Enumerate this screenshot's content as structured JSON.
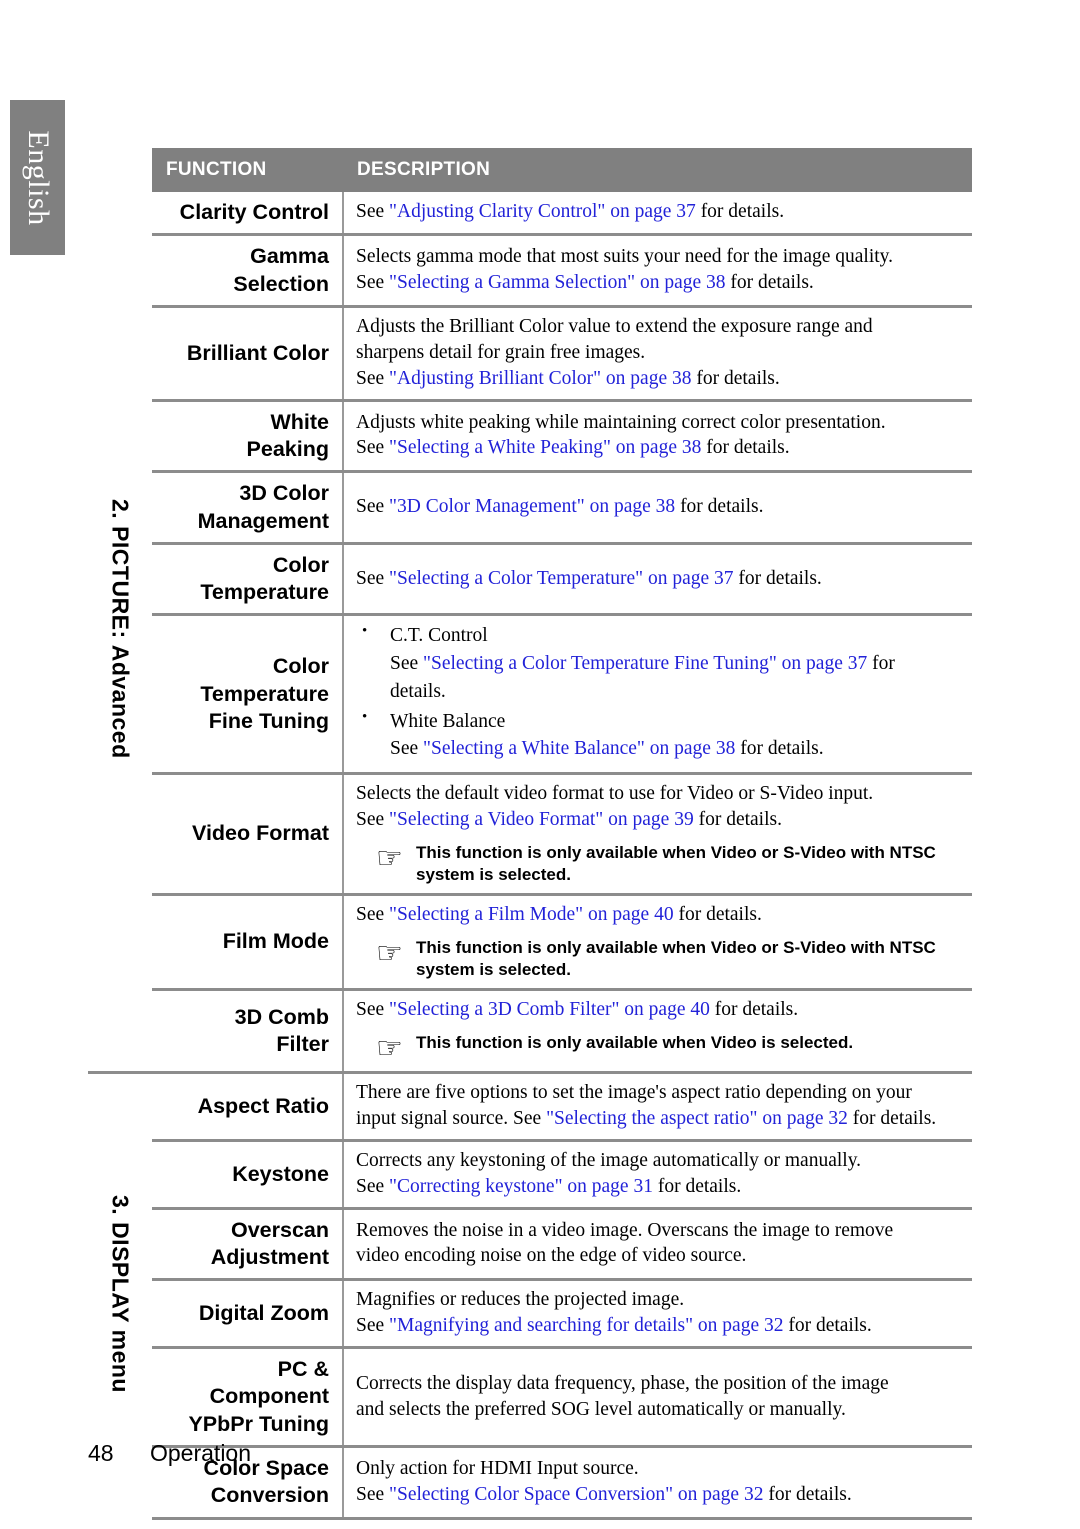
{
  "sidebar": {
    "language_tab": "English"
  },
  "table": {
    "headers": {
      "function": "FUNCTION",
      "description": "DESCRIPTION"
    },
    "sections": [
      {
        "label": "2. PICTURE: Advanced",
        "rows": [
          {
            "function": "Clarity Control",
            "lines": [
              {
                "pre": "See ",
                "link": "\"Adjusting Clarity Control\" on page 37",
                "post": " for details."
              }
            ]
          },
          {
            "function": "Gamma\nSelection",
            "lines": [
              {
                "pre": "Selects gamma mode that most suits your need for the image quality.",
                "link": "",
                "post": ""
              },
              {
                "pre": "See ",
                "link": "\"Selecting a Gamma Selection\" on page 38",
                "post": " for details."
              }
            ]
          },
          {
            "function": "Brilliant Color",
            "lines": [
              {
                "pre": "Adjusts the Brilliant Color value to extend the exposure range and",
                "link": "",
                "post": ""
              },
              {
                "pre": "sharpens detail for grain free images.",
                "link": "",
                "post": ""
              },
              {
                "pre": "See ",
                "link": "\"Adjusting Brilliant Color\" on page 38",
                "post": " for details."
              }
            ]
          },
          {
            "function": "White\nPeaking",
            "lines": [
              {
                "pre": "Adjusts white peaking while maintaining correct color presentation.",
                "link": "",
                "post": ""
              },
              {
                "pre": "See ",
                "link": "\"Selecting a White Peaking\" on page 38",
                "post": " for details."
              }
            ]
          },
          {
            "function": "3D Color\nManagement",
            "lines": [
              {
                "pre": "See ",
                "link": "\"3D Color Management\" on page 38",
                "post": " for details."
              }
            ]
          },
          {
            "function": "Color\nTemperature",
            "lines": [
              {
                "pre": "See ",
                "link": "\"Selecting a Color Temperature\" on page 37",
                "post": " for details."
              }
            ]
          },
          {
            "function": "Color\nTemperature\nFine Tuning",
            "bullets": [
              {
                "title": "C.T. Control",
                "lines": [
                  {
                    "pre": "See ",
                    "link": "\"Selecting a Color Temperature Fine Tuning\" on page 37",
                    "post": " for"
                  },
                  {
                    "pre": "details.",
                    "link": "",
                    "post": ""
                  }
                ]
              },
              {
                "title": "White Balance",
                "lines": [
                  {
                    "pre": "See ",
                    "link": "\"Selecting a White Balance\" on page 38",
                    "post": " for details."
                  }
                ]
              }
            ]
          },
          {
            "function": "Video Format",
            "lines": [
              {
                "pre": "Selects the default video format to use for Video or S-Video input.",
                "link": "",
                "post": ""
              },
              {
                "pre": "See ",
                "link": "\"Selecting a Video Format\" on page 39",
                "post": " for details."
              }
            ],
            "note": {
              "icon": "pointing-hand-icon",
              "text": "This function is only available when Video or S-Video with NTSC system is selected."
            }
          },
          {
            "function": "Film Mode",
            "lines": [
              {
                "pre": "See ",
                "link": "\"Selecting a Film Mode\" on page 40",
                "post": " for details."
              }
            ],
            "note": {
              "icon": "pointing-hand-icon",
              "text": "This function is only available when Video or S-Video with NTSC system is selected."
            }
          },
          {
            "function": "3D Comb\nFilter",
            "lines": [
              {
                "pre": "See ",
                "link": "\"Selecting a 3D Comb Filter\" on page 40",
                "post": " for details."
              }
            ],
            "note": {
              "icon": "pointing-hand-icon",
              "text": "This function is only available when Video is selected."
            }
          }
        ]
      },
      {
        "label": "3. DISPLAY menu",
        "rows": [
          {
            "function": "Aspect Ratio",
            "lines": [
              {
                "pre": "There are five options to set the image's aspect ratio depending on your",
                "link": "",
                "post": ""
              },
              {
                "pre": "input signal source. See ",
                "link": "\"Selecting the aspect ratio\" on page 32",
                "post": " for details."
              }
            ]
          },
          {
            "function": "Keystone",
            "lines": [
              {
                "pre": "Corrects any keystoning of the image automatically or manually.",
                "link": "",
                "post": ""
              },
              {
                "pre": "See ",
                "link": "\"Correcting keystone\" on page 31",
                "post": " for details."
              }
            ]
          },
          {
            "function": "Overscan\nAdjustment",
            "lines": [
              {
                "pre": "Removes the noise in a video image. Overscans the image to remove",
                "link": "",
                "post": ""
              },
              {
                "pre": "video encoding noise on the edge of video source.",
                "link": "",
                "post": ""
              }
            ]
          },
          {
            "function": "Digital Zoom",
            "lines": [
              {
                "pre": "Magnifies or reduces the projected image.",
                "link": "",
                "post": ""
              },
              {
                "pre": "See ",
                "link": "\"Magnifying and searching for details\" on page 32",
                "post": " for details."
              }
            ]
          },
          {
            "function": "PC &\nComponent\nYPbPr Tuning",
            "lines": [
              {
                "pre": "Corrects the display data frequency, phase, the position of the image",
                "link": "",
                "post": ""
              },
              {
                "pre": "and selects the preferred SOG level automatically or manually.",
                "link": "",
                "post": ""
              }
            ]
          },
          {
            "function": "Color Space\nConversion",
            "lines": [
              {
                "pre": "Only action for HDMI Input source.",
                "link": "",
                "post": ""
              },
              {
                "pre": "See ",
                "link": "\"Selecting Color Space Conversion\" on page 32",
                "post": " for details."
              }
            ]
          }
        ]
      }
    ]
  },
  "footer": {
    "page_number": "48",
    "chapter": "Operation"
  },
  "colors": {
    "header_bg": "#808080",
    "link": "#2222d8",
    "rule": "#8c8c8c"
  }
}
